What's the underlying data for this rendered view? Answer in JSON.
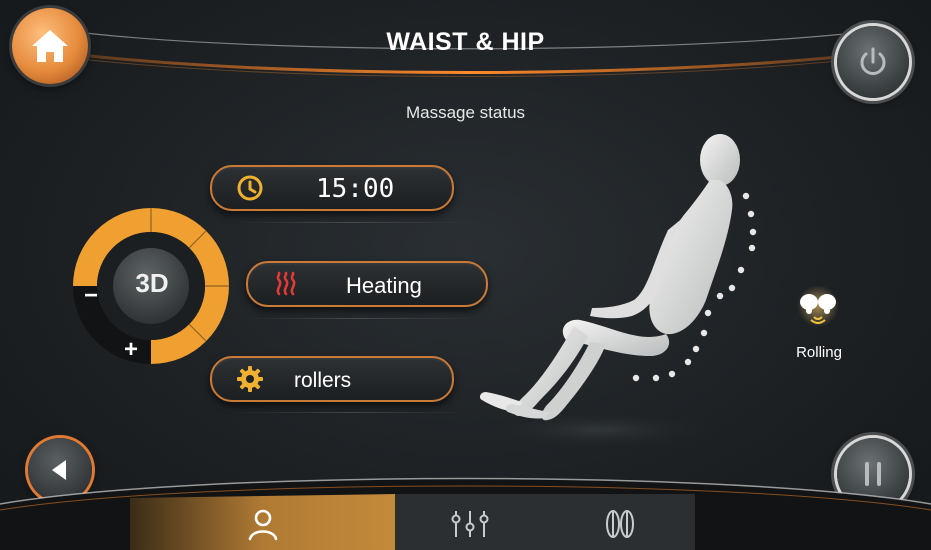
{
  "header": {
    "title": "WAIST & HIP",
    "subtitle": "Massage status"
  },
  "status": {
    "time": "15:00",
    "heating": "Heating",
    "rollers": "rollers"
  },
  "dial": {
    "label": "3D",
    "minus": "−",
    "plus": "+",
    "level": 0.75
  },
  "side": {
    "rolling_label": "Rolling"
  },
  "icons": {
    "home": "home-icon",
    "power": "power-icon",
    "pause": "pause-icon",
    "back": "back-arrow-icon",
    "clock": "clock-icon",
    "heat": "heat-waves-icon",
    "gear": "gear-icon",
    "rolling": "rolling-hands-icon",
    "user": "person-icon",
    "adjust": "sliders-icon",
    "rollers": "rollers-icon"
  },
  "colors": {
    "accent": "#e8a030",
    "orange": "#e07a32",
    "heat_red": "#e53935"
  }
}
